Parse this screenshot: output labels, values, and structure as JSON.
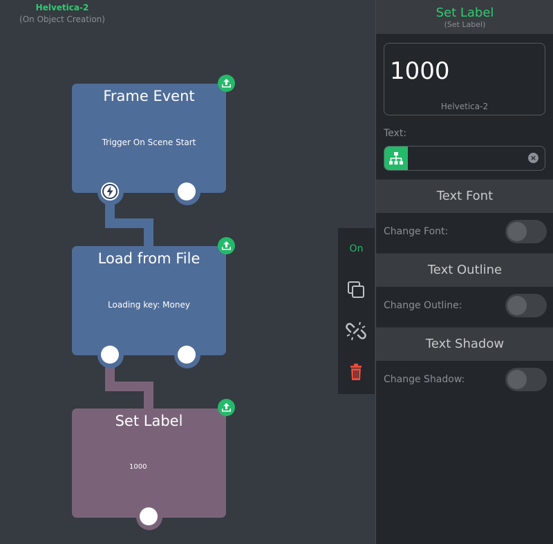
{
  "canvas": {
    "object_name": "Helvetica-2",
    "object_event": "(On Object Creation)"
  },
  "nodes": [
    {
      "title": "Frame Event",
      "description": "Trigger On Scene Start",
      "color": "#4f6d99"
    },
    {
      "title": "Load from File",
      "description": "Loading key: Money",
      "color": "#4f6d99"
    },
    {
      "title": "Set Label",
      "description": "1000",
      "color": "#7a6378"
    }
  ],
  "toolbar": {
    "toggle_label": "On",
    "icons": [
      "duplicate-icon",
      "unlink-icon",
      "trash-icon"
    ]
  },
  "panel": {
    "title": "Set Label",
    "subtitle": "(Set Label)",
    "preview_text": "1000",
    "preview_caption": "Helvetica-2",
    "text_label": "Text:",
    "text_value": "",
    "sections": [
      {
        "heading": "Text Font",
        "option_label": "Change Font:",
        "enabled": false
      },
      {
        "heading": "Text Outline",
        "option_label": "Change Outline:",
        "enabled": false
      },
      {
        "heading": "Text Shadow",
        "option_label": "Change Shadow:",
        "enabled": false
      }
    ]
  },
  "colors": {
    "accent": "#25b96a",
    "delete": "#e74c3c",
    "background": "#363a41",
    "panel": "#23262a"
  }
}
